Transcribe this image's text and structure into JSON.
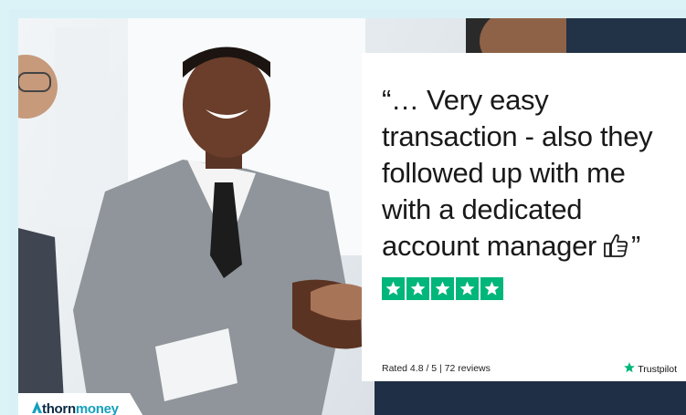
{
  "review": {
    "quote": "“… Very easy transaction - also they followed up with me with a dedicated account manager",
    "closing_quote": "”",
    "rating_text": "Rated 4.8 / 5 | 72 reviews",
    "stars": 5,
    "platform": "Trustpilot"
  },
  "brand": {
    "part1": "thorn",
    "part2": "money"
  },
  "colors": {
    "frame": "#dbf2f7",
    "star": "#00b67a",
    "brand_dark": "#0a2a45",
    "brand_accent": "#16a0bd"
  }
}
